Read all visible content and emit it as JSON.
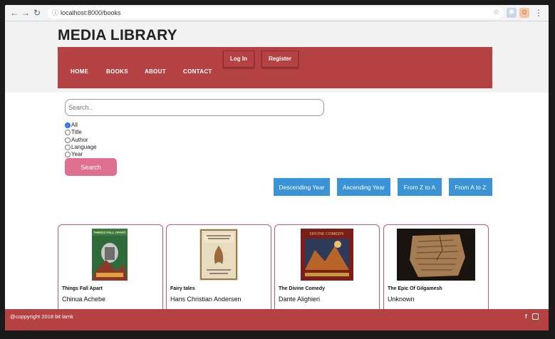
{
  "browser": {
    "url": "localhost:8000/books",
    "back_icon": "back-arrow-icon",
    "forward_icon": "forward-arrow-icon",
    "reload_icon": "reload-icon"
  },
  "site": {
    "title": "MEDIA LIBRARY"
  },
  "nav": {
    "items": [
      "HOME",
      "BOOKS",
      "ABOUT",
      "CONTACT"
    ],
    "login": "Log In",
    "register": "Register"
  },
  "search": {
    "placeholder": "Search..",
    "filters": [
      "All",
      "Title",
      "Author",
      "Language",
      "Year"
    ],
    "selected": "All",
    "button": "Search"
  },
  "sort": {
    "buttons": [
      "Descending Year",
      "Ascending Year",
      "From Z to A",
      "From A to Z"
    ]
  },
  "books": [
    {
      "title": "Things Fall Apart",
      "author": "Chinua Achebe"
    },
    {
      "title": "Fairy tales",
      "author": "Hans Christian Andersen"
    },
    {
      "title": "The Divine Comedy",
      "author": "Dante Alighieri"
    },
    {
      "title": "The Epic Of Gilgamesh",
      "author": "Unknown"
    }
  ],
  "footer": {
    "copyright": "@coppyright 2018 bit lamk"
  },
  "colors": {
    "brand": "#b54242",
    "search_button": "#e07090",
    "sort_button": "#3a93d6"
  }
}
